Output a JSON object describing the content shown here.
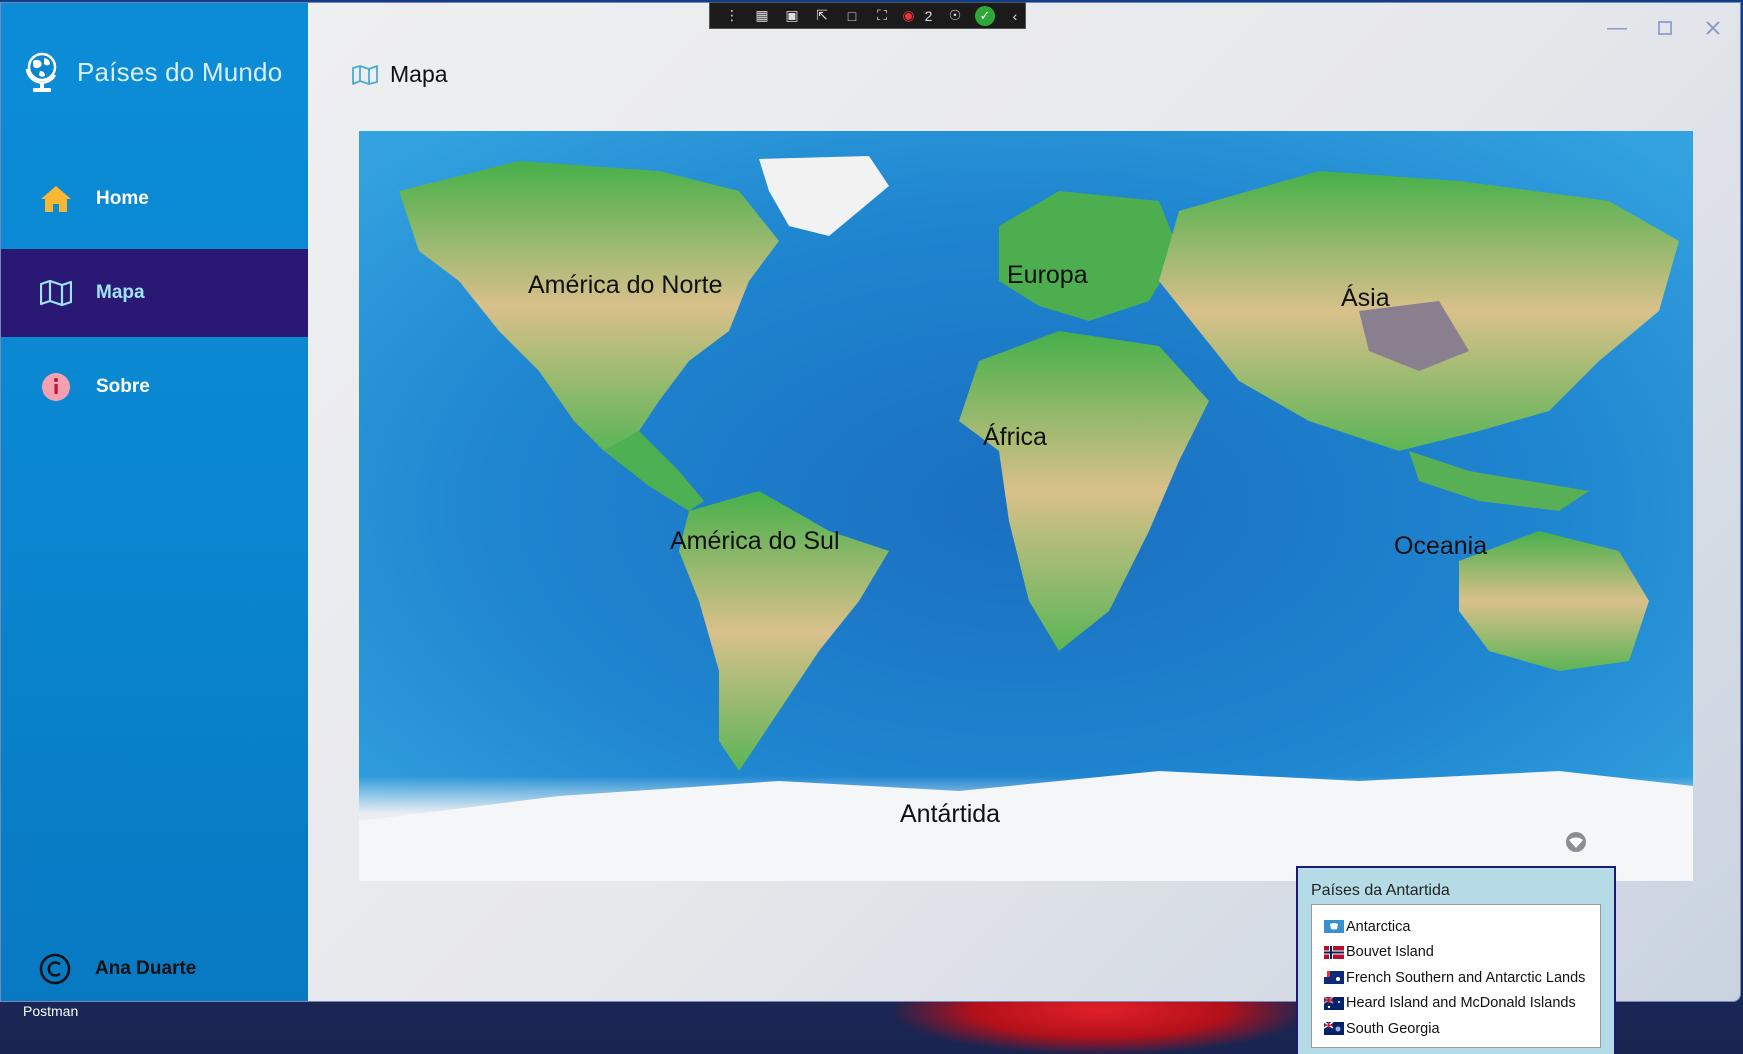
{
  "app": {
    "title": "Países do Mundo",
    "icon": "globe-icon"
  },
  "sidebar": {
    "items": [
      {
        "label": "Home",
        "icon": "home-icon",
        "active": false
      },
      {
        "label": "Mapa",
        "icon": "map-icon",
        "active": true
      },
      {
        "label": "Sobre",
        "icon": "info-icon",
        "active": false
      }
    ],
    "footer": {
      "label": "Ana Duarte",
      "icon": "copyright-icon"
    }
  },
  "header": {
    "title": "Mapa",
    "icon": "map-icon"
  },
  "debug_toolbar": {
    "counter": "2"
  },
  "map": {
    "labels": [
      "América do Norte",
      "Europa",
      "Ásia",
      "África",
      "América do Sul",
      "Oceania",
      "Antártida"
    ]
  },
  "popup": {
    "title": "Países da Antartida",
    "items": [
      {
        "name": "Antarctica",
        "flag": "flag-antarctica"
      },
      {
        "name": "Bouvet Island",
        "flag": "flag-norway"
      },
      {
        "name": "French Southern and Antarctic Lands",
        "flag": "flag-french-southern"
      },
      {
        "name": "Heard Island and McDonald Islands",
        "flag": "flag-australia"
      },
      {
        "name": "South Georgia",
        "flag": "flag-south-georgia"
      }
    ]
  },
  "taskbar": {
    "label": "Postman"
  },
  "colors": {
    "sidebar": "#0a86d0",
    "active_nav": "#2a1875",
    "active_text": "#9fe4f4",
    "popup_bg": "#b4dbe6"
  }
}
